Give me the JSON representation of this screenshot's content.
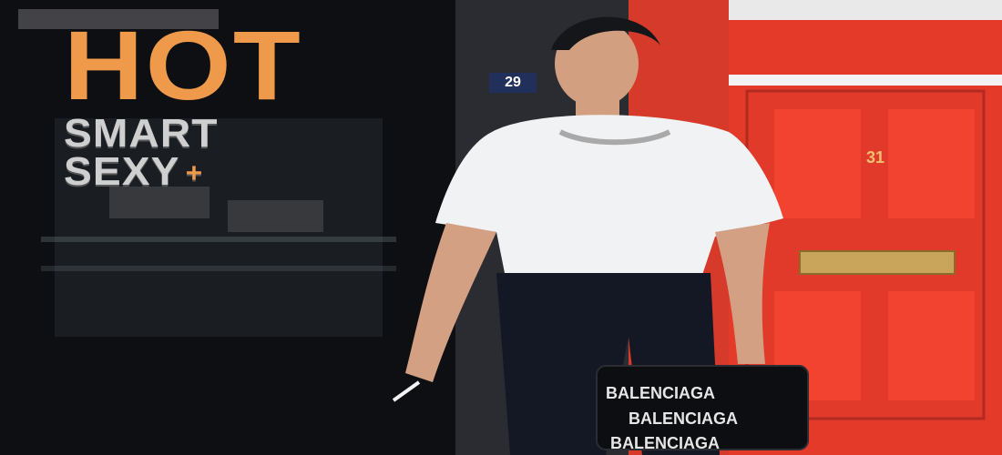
{
  "cover": {
    "headline": "HOT",
    "line2": "SMART",
    "line3": "SEXY",
    "plus": "+"
  },
  "scene": {
    "building_number": "29",
    "door_number": "31",
    "bag_text": "BALENCIAGA",
    "colors": {
      "orange": "#EE9A4A",
      "red_door": "#E33A2A",
      "shirt": "#F1F2F4",
      "trousers": "#141824"
    }
  }
}
